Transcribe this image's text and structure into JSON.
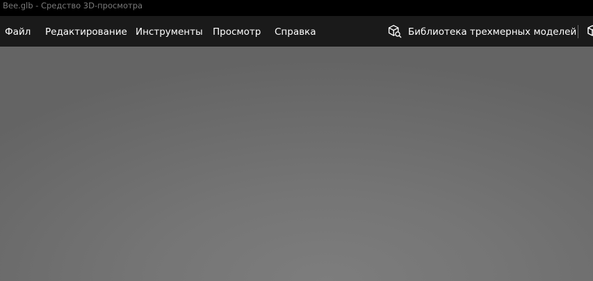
{
  "window": {
    "title": "Bee.glb - Средство 3D-просмотра"
  },
  "menu": {
    "items": [
      {
        "label": "Файл"
      },
      {
        "label": "Редактирование"
      },
      {
        "label": "Инструменты"
      },
      {
        "label": "Просмотр"
      },
      {
        "label": "Справка"
      }
    ],
    "library_button": {
      "label": "Библиотека трехмерных моделей",
      "icon": "3d-cube-icon"
    },
    "overflow_icon": "3d-object-icon"
  },
  "colors": {
    "titlebar_bg": "#000000",
    "menubar_bg": "#1a1a1a",
    "viewport_bg": "#737373",
    "menu_text": "#ffffff",
    "title_text": "#7a7a7a"
  }
}
